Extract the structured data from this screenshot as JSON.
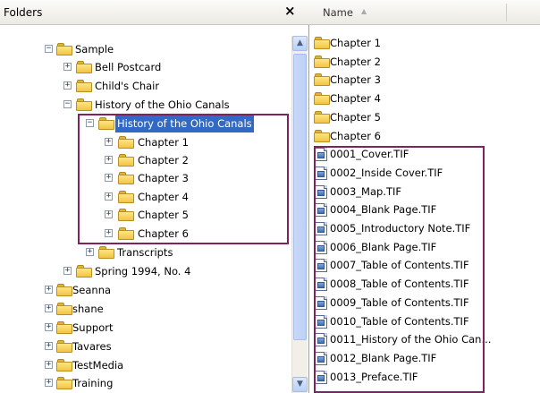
{
  "folders_pane": {
    "title": "Folders",
    "close_glyph": "×"
  },
  "tree": [
    {
      "label": "Sample",
      "level": 0,
      "expander": "−"
    },
    {
      "label": "Bell Postcard",
      "level": 1,
      "expander": "+"
    },
    {
      "label": "Child's Chair",
      "level": 1,
      "expander": "+"
    },
    {
      "label": "History of the Ohio Canals",
      "level": 1,
      "expander": "−"
    },
    {
      "label": "History of the Ohio Canals",
      "level": 2,
      "expander": "−",
      "selected": true
    },
    {
      "label": "Chapter 1",
      "level": 3,
      "expander": "+"
    },
    {
      "label": "Chapter 2",
      "level": 3,
      "expander": "+"
    },
    {
      "label": "Chapter 3",
      "level": 3,
      "expander": "+"
    },
    {
      "label": "Chapter 4",
      "level": 3,
      "expander": "+"
    },
    {
      "label": "Chapter 5",
      "level": 3,
      "expander": "+"
    },
    {
      "label": "Chapter 6",
      "level": 3,
      "expander": "+"
    },
    {
      "label": "Transcripts",
      "level": 2,
      "expander": "+"
    },
    {
      "label": "Spring 1994, No. 4",
      "level": 1,
      "expander": "+"
    },
    {
      "label": "Seanna",
      "level": -1,
      "expander": "+"
    },
    {
      "label": "shane",
      "level": -1,
      "expander": "+"
    },
    {
      "label": "Support",
      "level": -1,
      "expander": "+"
    },
    {
      "label": "Tavares",
      "level": -1,
      "expander": "+"
    },
    {
      "label": "TestMedia",
      "level": -1,
      "expander": "+"
    },
    {
      "label": "Training",
      "level": -1,
      "expander": "+"
    }
  ],
  "list_pane": {
    "column_name": "Name",
    "sort_glyph": "▲"
  },
  "files": [
    {
      "name": "Chapter 1",
      "kind": "folder"
    },
    {
      "name": "Chapter 2",
      "kind": "folder"
    },
    {
      "name": "Chapter 3",
      "kind": "folder"
    },
    {
      "name": "Chapter 4",
      "kind": "folder"
    },
    {
      "name": "Chapter 5",
      "kind": "folder"
    },
    {
      "name": "Chapter 6",
      "kind": "folder"
    },
    {
      "name": "0001_Cover.TIF",
      "kind": "tif"
    },
    {
      "name": "0002_Inside Cover.TIF",
      "kind": "tif"
    },
    {
      "name": "0003_Map.TIF",
      "kind": "tif"
    },
    {
      "name": "0004_Blank Page.TIF",
      "kind": "tif"
    },
    {
      "name": "0005_Introductory Note.TIF",
      "kind": "tif"
    },
    {
      "name": "0006_Blank Page.TIF",
      "kind": "tif"
    },
    {
      "name": "0007_Table of Contents.TIF",
      "kind": "tif"
    },
    {
      "name": "0008_Table of Contents.TIF",
      "kind": "tif"
    },
    {
      "name": "0009_Table of Contents.TIF",
      "kind": "tif"
    },
    {
      "name": "0010_Table of Contents.TIF",
      "kind": "tif"
    },
    {
      "name": "0011_History of the Ohio Can...",
      "kind": "tif"
    },
    {
      "name": "0012_Blank Page.TIF",
      "kind": "tif"
    },
    {
      "name": "0013_Preface.TIF",
      "kind": "tif"
    }
  ],
  "colors": {
    "highlight_box": "#7d2460",
    "selection": "#316ac5",
    "folder_yellow": "#f1c445"
  }
}
